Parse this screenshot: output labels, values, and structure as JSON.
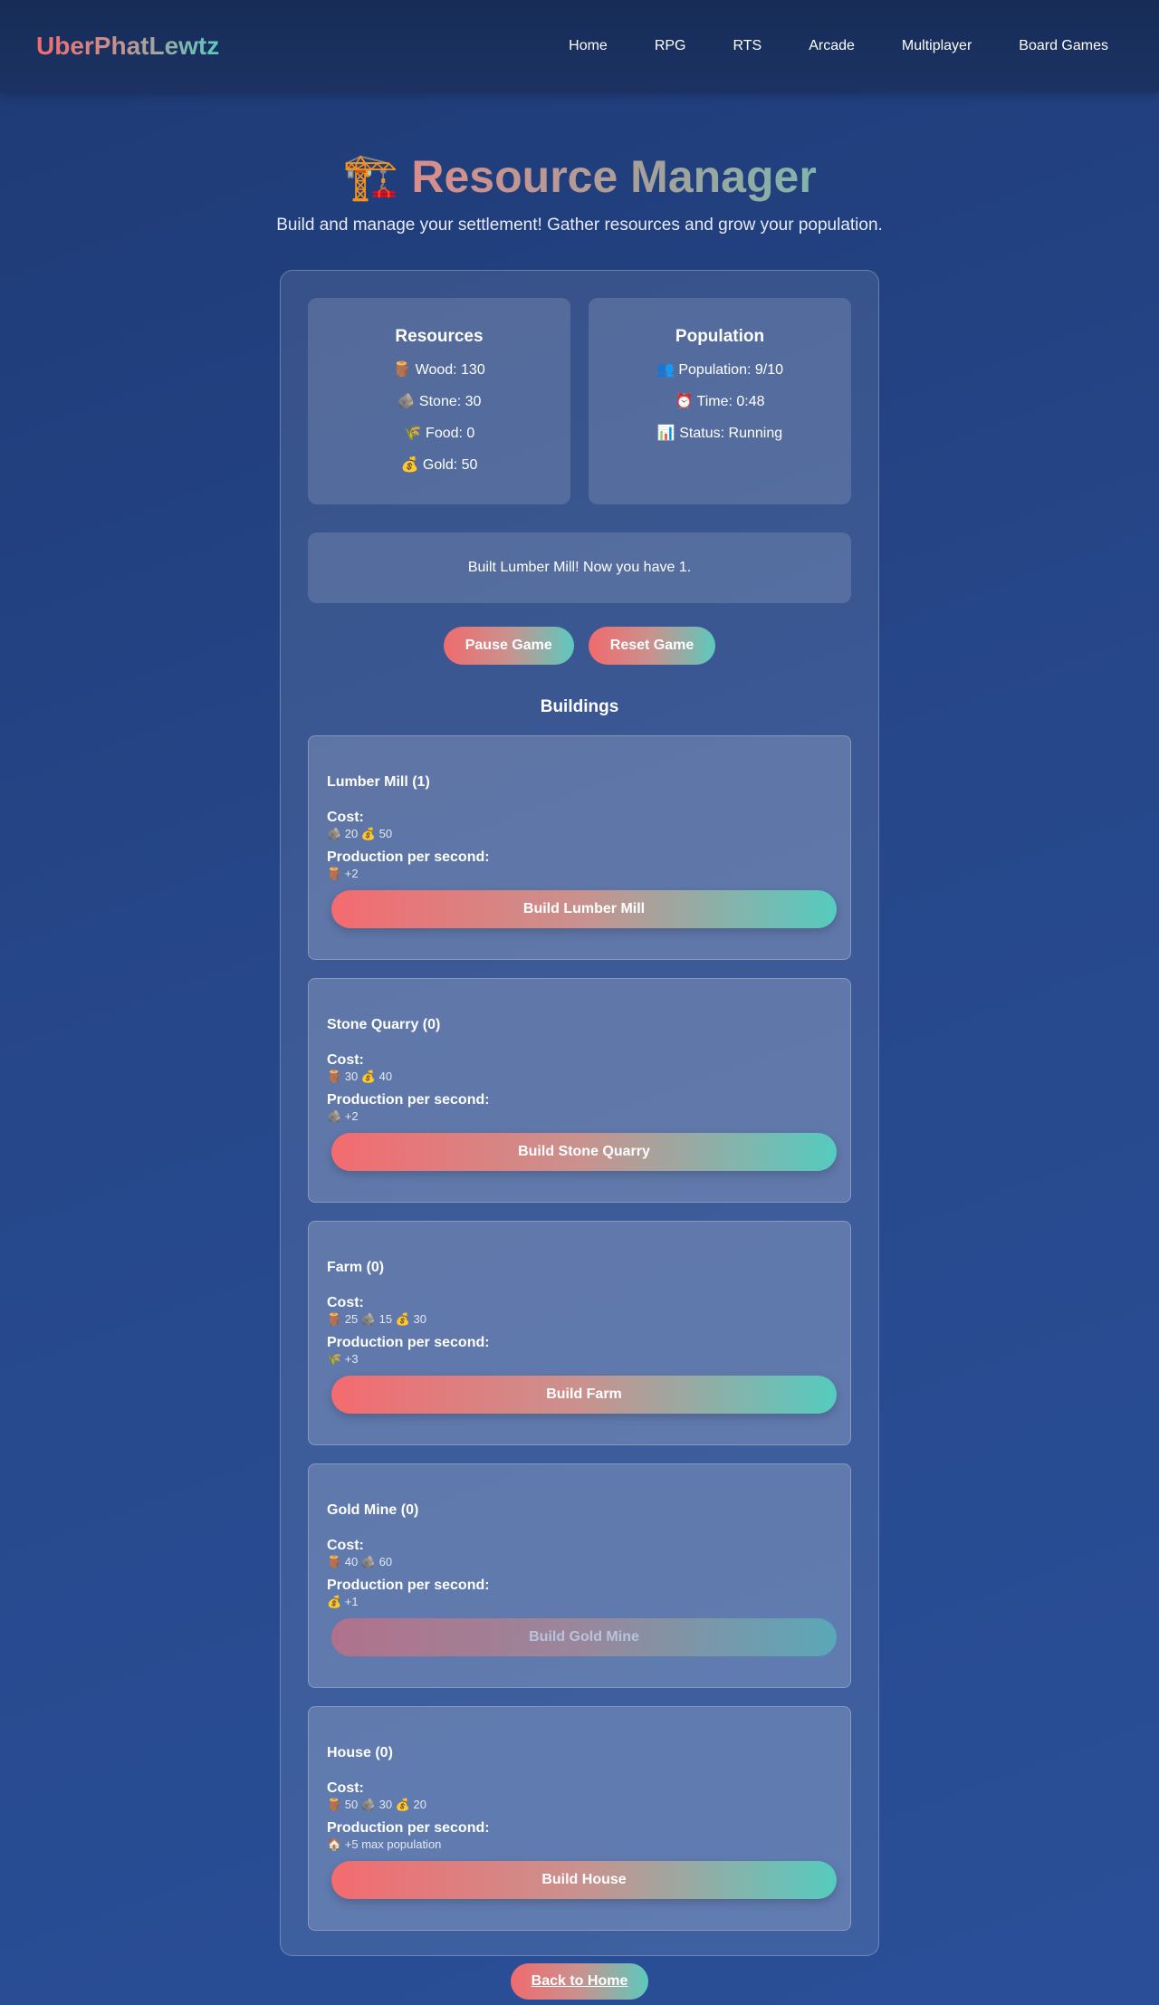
{
  "nav": {
    "brand": "UberPhatLewtz",
    "links": [
      "Home",
      "RPG",
      "RTS",
      "Arcade",
      "Multiplayer",
      "Board Games"
    ]
  },
  "hero": {
    "emoji": "🏗️",
    "title": "Resource Manager",
    "subtitle": "Build and manage your settlement! Gather resources and grow your population."
  },
  "resources": {
    "title": "Resources",
    "lines": [
      "🪵 Wood: 130",
      "🪨 Stone: 30",
      "🌾 Food: 0",
      "💰 Gold: 50"
    ]
  },
  "population": {
    "title": "Population",
    "lines": [
      "👥 Population: 9/10",
      "⏰ Time: 0:48",
      "📊 Status: Running"
    ]
  },
  "message": "Built Lumber Mill! Now you have 1.",
  "controls": {
    "pause": "Pause Game",
    "reset": "Reset Game"
  },
  "buildings_title": "Buildings",
  "cost_label": "Cost:",
  "production_label": "Production per second:",
  "buildings": [
    {
      "name": "Lumber Mill (1)",
      "cost": "🪨 20 💰 50",
      "production": "🪵 +2",
      "button": "Build Lumber Mill",
      "enabled": true
    },
    {
      "name": "Stone Quarry (0)",
      "cost": "🪵 30 💰 40",
      "production": "🪨 +2",
      "button": "Build Stone Quarry",
      "enabled": true
    },
    {
      "name": "Farm (0)",
      "cost": "🪵 25 🪨 15 💰 30",
      "production": "🌾 +3",
      "button": "Build Farm",
      "enabled": true
    },
    {
      "name": "Gold Mine (0)",
      "cost": "🪵 40 🪨 60",
      "production": "💰 +1",
      "button": "Build Gold Mine",
      "enabled": false
    },
    {
      "name": "House (0)",
      "cost": "🪵 50 🪨 30 💰 20",
      "production": "🏠 +5 max population",
      "button": "Build House",
      "enabled": true
    }
  ],
  "back": "Back to Home"
}
